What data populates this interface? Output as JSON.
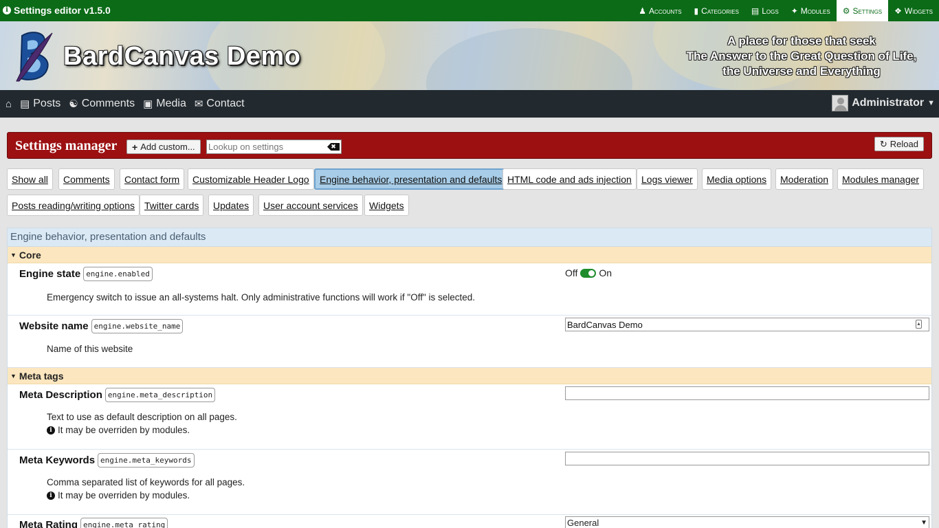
{
  "admin_bar": {
    "title": "Settings editor v1.5.0",
    "menu": [
      {
        "label": "Accounts",
        "icon": "users-icon"
      },
      {
        "label": "Categories",
        "icon": "folder-icon"
      },
      {
        "label": "Logs",
        "icon": "file-icon"
      },
      {
        "label": "Modules",
        "icon": "puzzle-icon"
      },
      {
        "label": "Settings",
        "icon": "gears-icon",
        "active": true
      },
      {
        "label": "Widgets",
        "icon": "cubes-icon"
      }
    ]
  },
  "header": {
    "site_title": "BardCanvas Demo",
    "tagline_lines": [
      "A place for those that seek",
      "The Answer to the Great Question of Life,",
      "the Universe and Everything"
    ]
  },
  "nav": {
    "items": [
      {
        "label": "",
        "icon": "home-icon"
      },
      {
        "label": "Posts",
        "icon": "newspaper-icon"
      },
      {
        "label": "Comments",
        "icon": "comments-icon"
      },
      {
        "label": "Media",
        "icon": "image-icon"
      },
      {
        "label": "Contact",
        "icon": "envelope-icon"
      }
    ],
    "user": {
      "name": "Administrator"
    }
  },
  "settings_manager": {
    "title": "Settings manager",
    "add_button": "Add custom...",
    "lookup_placeholder": "Lookup on settings",
    "reload_button": "Reload"
  },
  "filters": [
    {
      "label": "Show all"
    },
    {
      "label": "Comments"
    },
    {
      "label": "Contact form"
    },
    {
      "label": "Customizable Header Logo"
    },
    {
      "label": "Engine behavior, presentation and defaults",
      "active": true
    },
    {
      "label": "HTML code and ads injection"
    },
    {
      "label": "Logs viewer"
    },
    {
      "label": "Media options"
    },
    {
      "label": "Moderation"
    },
    {
      "label": "Modules manager"
    },
    {
      "label": "Posts reading/writing options"
    },
    {
      "label": "Twitter cards"
    },
    {
      "label": "Updates"
    },
    {
      "label": "User account services"
    },
    {
      "label": "Widgets"
    }
  ],
  "panel": {
    "title": "Engine behavior, presentation and defaults",
    "sections": {
      "core": "Core",
      "meta": "Meta tags"
    },
    "settings": {
      "engine_state": {
        "label": "Engine state",
        "key": "engine.enabled",
        "desc": "Emergency switch to issue an all-systems halt. Only administrative functions will work if \"Off\" is selected.",
        "off_label": "Off",
        "on_label": "On",
        "value": "On"
      },
      "website_name": {
        "label": "Website name",
        "key": "engine.website_name",
        "desc": "Name of this website",
        "value": "BardCanvas Demo"
      },
      "meta_description": {
        "label": "Meta Description",
        "key": "engine.meta_description",
        "desc": "Text to use as default description on all pages.",
        "note": "It may be overriden by modules.",
        "value": ""
      },
      "meta_keywords": {
        "label": "Meta Keywords",
        "key": "engine.meta_keywords",
        "desc": "Comma separated list of keywords for all pages.",
        "note": "It may be overriden by modules.",
        "value": ""
      },
      "meta_rating": {
        "label": "Meta Rating",
        "key": "engine.meta_rating",
        "value": "General"
      }
    }
  },
  "colors": {
    "admin_bar": "#0b6b17",
    "nav": "#222a30",
    "settings_bar": "#9c1012",
    "section": "#fbe6bf",
    "active_filter": "#a8cde8",
    "toggle_on": "#1e8c2a"
  }
}
